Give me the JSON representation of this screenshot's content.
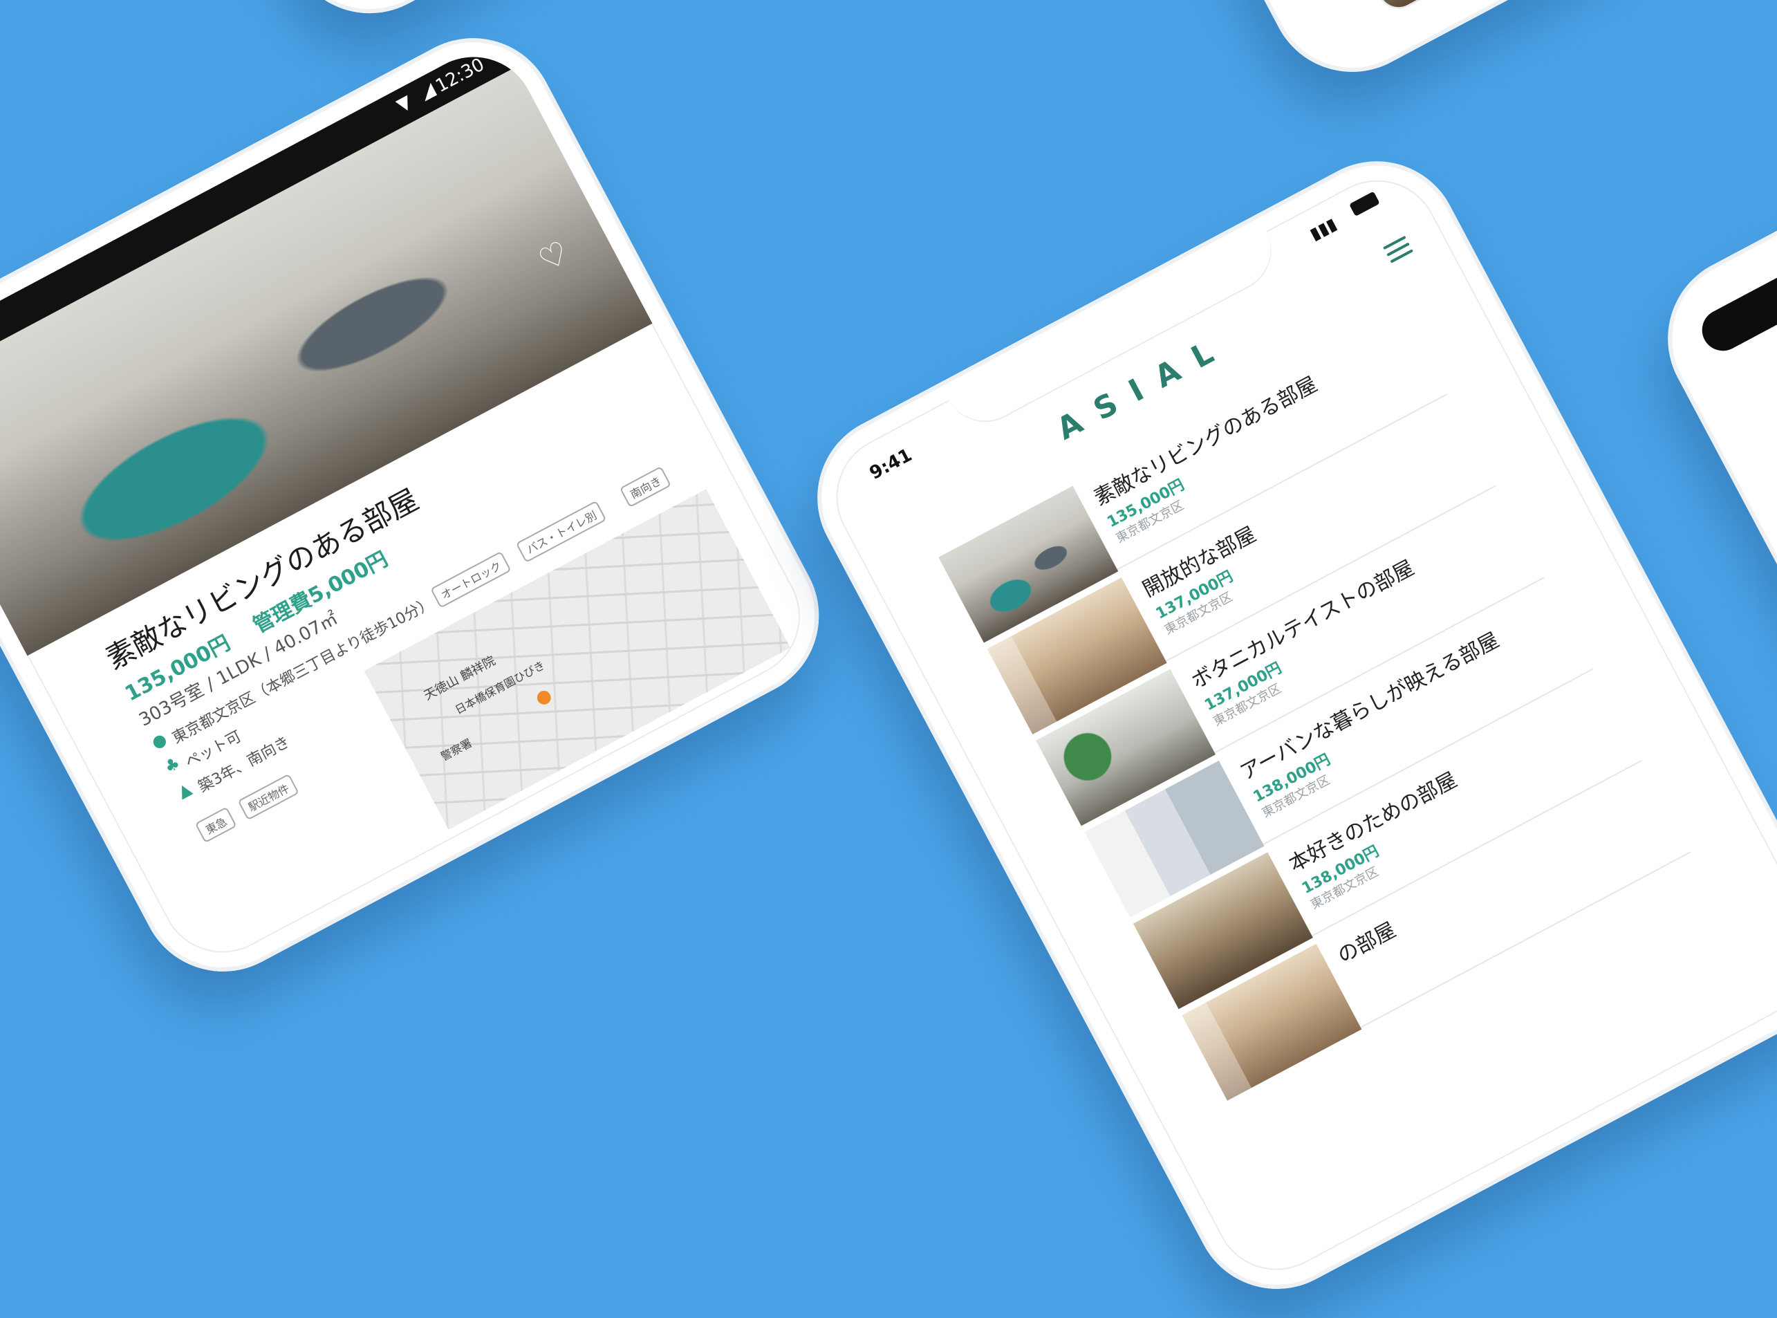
{
  "background_color": "#49a2e6",
  "accent_color": "#2a7e6b",
  "price_color": "#2fa18a",
  "list_phone": {
    "status_time": "9:41",
    "logo": "ASIAL",
    "menu_icon": "hamburger-icon",
    "items": [
      {
        "title": "素敵なリビングのある部屋",
        "price": "135,000円",
        "location": "東京都文京区"
      },
      {
        "title": "開放的な部屋",
        "price": "137,000円",
        "location": "東京都文京区"
      },
      {
        "title": "ボタニカルテイストの部屋",
        "price": "137,000円",
        "location": "東京都文京区"
      },
      {
        "title": "アーバンな暮らしが映える部屋",
        "price": "138,000円",
        "location": "東京都文京区"
      },
      {
        "title": "本好きのための部屋",
        "price": "138,000円",
        "location": "東京都文京区"
      },
      {
        "title": "の部屋",
        "price": "",
        "location": ""
      }
    ]
  },
  "detail_phone": {
    "status_time": "12:30",
    "title": "素敵なリビングのある部屋",
    "price": "135,000円",
    "management_fee": "管理費5,000円",
    "room_info": "303号室 / 1LDK / 40.07㎡",
    "address": "東京都文京区（本郷三丁目より徒歩10分）",
    "pet": "ペット可",
    "age": "築3年、南向き",
    "tags_row1": [
      "オートロック",
      "バス・トイレ別",
      "南向き"
    ],
    "tags_row2": [
      "東急",
      "駅近物件"
    ],
    "map_labels": [
      "天徳山 麟祥院",
      "日本橋保育園ひびき",
      "警察署"
    ]
  }
}
